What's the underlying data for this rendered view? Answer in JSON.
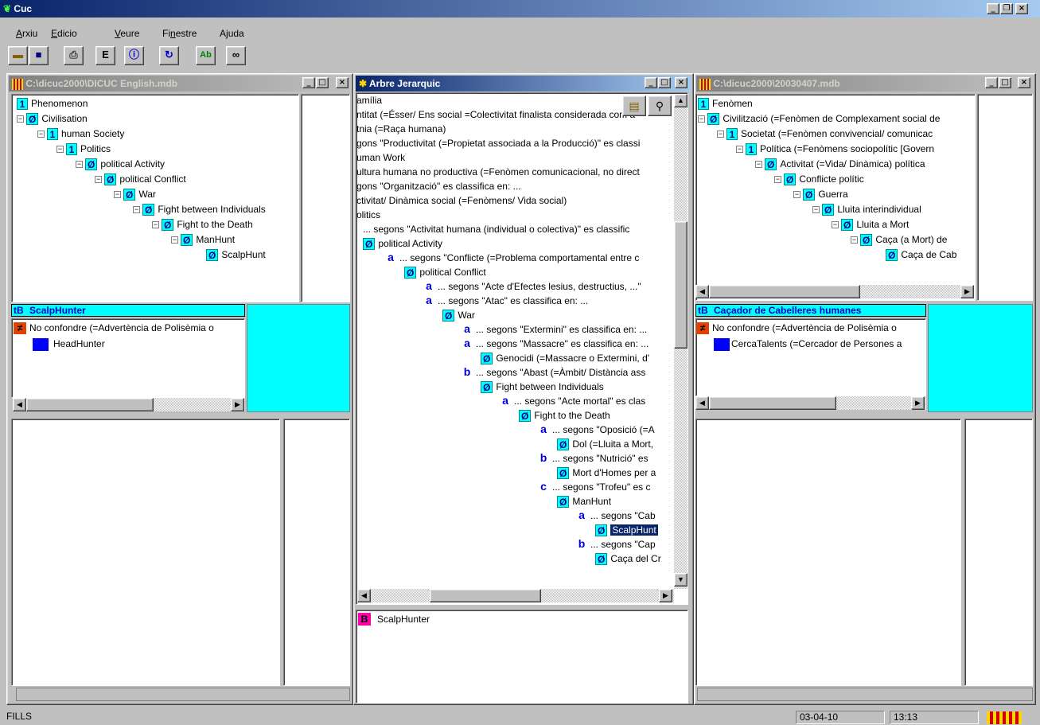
{
  "app": {
    "title": "Cuc"
  },
  "menu": [
    "Arxiu",
    "Edicio",
    "Veure",
    "Finestre",
    "Ajuda"
  ],
  "menu_mnemonic": [
    "A",
    "E",
    "V",
    "n",
    "j"
  ],
  "toolbar": [
    "open-icon",
    "save-icon",
    "print-icon",
    "tree-icon",
    "info-icon",
    "refresh-icon",
    "spellcheck-icon",
    "link-icon"
  ],
  "left": {
    "title": "C:\\dicuc2000\\DICUC English.mdb",
    "tree": [
      {
        "badge": "1",
        "text": "Phenomenon"
      },
      {
        "badge": "Ø",
        "text": "Civilisation"
      },
      {
        "badge": "1",
        "text": "human Society"
      },
      {
        "badge": "1",
        "text": "Politics"
      },
      {
        "badge": "Ø",
        "text": "political Activity"
      },
      {
        "badge": "Ø",
        "text": "political Conflict"
      },
      {
        "badge": "Ø",
        "text": "War"
      },
      {
        "badge": "Ø",
        "text": "Fight between Individuals"
      },
      {
        "badge": "Ø",
        "text": "Fight to the Death"
      },
      {
        "badge": "Ø",
        "text": "ManHunt"
      },
      {
        "badge": "Ø",
        "text": "ScalpHunt"
      }
    ],
    "term_badge": "tB",
    "term": "ScalpHunter",
    "relation": "No confondre (=Advertència de Polisèmia o",
    "related": "HeadHunter"
  },
  "center": {
    "title": "Arbre Jerarquic",
    "lines": [
      "amília",
      "ntitat (=Ésser/ Ens social =Colectivitat finalista considerada com a",
      "tnia (=Raça humana)",
      "gons \"Productivitat (=Propietat associada a la Producció)\" es classi",
      "uman Work",
      "ultura humana no productiva (=Fenòmen comunicacional, no direct",
      "gons \"Organització\" es classifica en: ...",
      "ctivitat/ Dinàmica social (=Fenòmens/ Vida social)",
      "olitics",
      "... segons \"Activitat humana (individual o colectiva)\" es classific",
      "political Activity",
      "... segons \"Conflicte (=Problema comportamental entre c",
      "political Conflict",
      "... segons \"Acte d'Efectes lesius, destructius, ...\"",
      "... segons \"Atac\" es classifica en: ...",
      "War",
      "... segons \"Extermini\" es classifica en: ...",
      "... segons \"Massacre\" es classifica en: ...",
      "Genocidi (=Massacre o Extermini, d'",
      "... segons \"Abast (=Àmbit/ Distància ass",
      "Fight between Individuals",
      "... segons \"Acte mortal\" es clas",
      "Fight to the Death",
      "... segons \"Oposició (=A",
      "Dol (=Lluita a Mort,",
      "... segons \"Nutrició\" es",
      "Mort d'Homes per a",
      "... segons \"Trofeu\" es c",
      "ManHunt",
      "... segons \"Cab",
      "ScalpHunt",
      "... segons \"Cap",
      "Caça del Cr"
    ],
    "bottom_badge": "B",
    "bottom_term": "ScalpHunter"
  },
  "right": {
    "title": "C:\\dicuc2000\\20030407.mdb",
    "tree": [
      {
        "badge": "1",
        "text": "Fenòmen"
      },
      {
        "badge": "Ø",
        "text": "Civilització (=Fenòmen de Complexament social de"
      },
      {
        "badge": "1",
        "text": "Societat (=Fenòmen convivencial/ comunicac"
      },
      {
        "badge": "1",
        "text": "Política (=Fenòmens sociopolític [Govern"
      },
      {
        "badge": "Ø",
        "text": "Activitat (=Vida/ Dinàmica) política"
      },
      {
        "badge": "Ø",
        "text": "Conflicte polític"
      },
      {
        "badge": "Ø",
        "text": "Guerra"
      },
      {
        "badge": "Ø",
        "text": "Lluita interindividual"
      },
      {
        "badge": "Ø",
        "text": "Lluita a Mort"
      },
      {
        "badge": "Ø",
        "text": "Caça (a Mort) de"
      },
      {
        "badge": "Ø",
        "text": "Caça de Cab"
      }
    ],
    "term_badge": "tB",
    "term": "Caçador de Cabelleres humanes",
    "relation": "No confondre (=Advertència de Polisèmia o",
    "related": "CercaTalents (=Cercador de Persones a"
  },
  "status": {
    "mode": "FILLS",
    "date": "03-04-10",
    "time": "13:13"
  },
  "window_controls": {
    "min": "_",
    "max": "□",
    "restore": "❐",
    "close": "×"
  }
}
